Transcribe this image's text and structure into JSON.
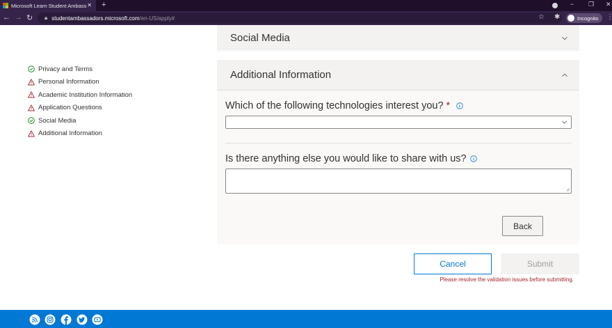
{
  "browser": {
    "tab_title": "Microsoft Learn Student Ambass",
    "url_host": "studentambassadors.microsoft.com",
    "url_path": "/en-US/apply#",
    "incognito_label": "Incognito"
  },
  "sidebar": {
    "items": [
      {
        "label": "Privacy and Terms",
        "status": "complete"
      },
      {
        "label": "Personal Information",
        "status": "error"
      },
      {
        "label": "Academic Institution Information",
        "status": "error"
      },
      {
        "label": "Application Questions",
        "status": "error"
      },
      {
        "label": "Social Media",
        "status": "complete"
      },
      {
        "label": "Additional Information",
        "status": "error"
      }
    ]
  },
  "sections": {
    "social_media": {
      "title": "Social Media",
      "expanded": false
    },
    "additional": {
      "title": "Additional Information",
      "expanded": true,
      "q1": {
        "label": "Which of the following technologies interest you?",
        "required_mark": "*",
        "value": ""
      },
      "q2": {
        "label": "Is there anything else you would like to share with us?",
        "value": ""
      },
      "back_label": "Back"
    }
  },
  "actions": {
    "cancel_label": "Cancel",
    "submit_label": "Submit",
    "validation_message": "Please resolve the validation issues before submitting."
  },
  "footer": {
    "social_icons": [
      "rss-icon",
      "instagram-icon",
      "facebook-icon",
      "twitter-icon",
      "youtube-icon"
    ]
  },
  "colors": {
    "accent": "#0078d4",
    "error": "#a4262c",
    "success": "#107c10",
    "browser_chrome": "#35234a"
  }
}
